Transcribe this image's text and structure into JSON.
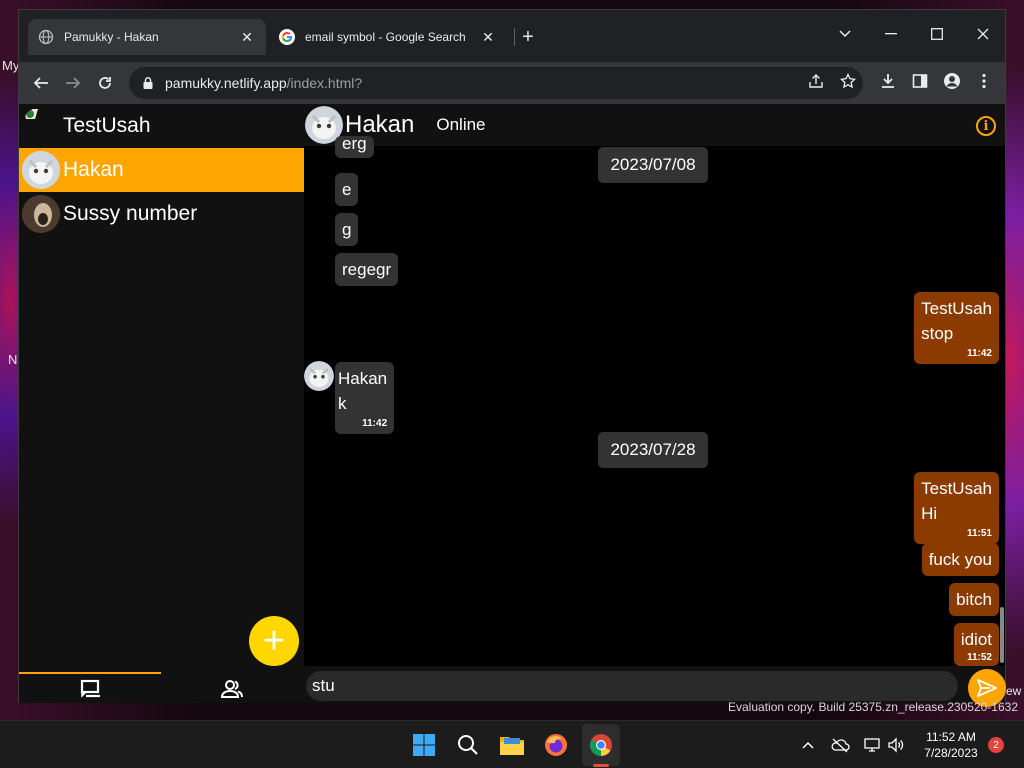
{
  "browser": {
    "tabs": [
      {
        "title": "Pamukky - Hakan",
        "active": true
      },
      {
        "title": "email symbol - Google Search",
        "active": false
      }
    ],
    "url_host": "pamukky.netlify.app",
    "url_path": "/index.html?"
  },
  "sidebar": {
    "contacts": [
      {
        "name": "TestUsah",
        "active": false
      },
      {
        "name": "Hakan",
        "active": true
      },
      {
        "name": "Sussy number",
        "active": false
      }
    ],
    "fab_label": "+"
  },
  "chat": {
    "contact_name": "Hakan",
    "status": "Online",
    "date_chips": [
      "2023/07/08",
      "2023/07/28"
    ],
    "messages": [
      {
        "text": "erg",
        "direction": "in"
      },
      {
        "text": "e",
        "direction": "in"
      },
      {
        "text": "g",
        "direction": "in"
      },
      {
        "text": "regegr",
        "direction": "in"
      },
      {
        "sender": "TestUsah",
        "text": "stop",
        "time": "11:42",
        "direction": "out"
      },
      {
        "sender": "Hakan",
        "text": "k",
        "time": "11:42",
        "direction": "in"
      },
      {
        "sender": "TestUsah",
        "text": "Hi",
        "time": "11:51",
        "direction": "out"
      },
      {
        "text": "fuck you",
        "direction": "out"
      },
      {
        "text": "bitch",
        "direction": "out"
      },
      {
        "text": "idiot",
        "time": "11:52",
        "direction": "out"
      }
    ],
    "composer_value": "stu"
  },
  "desktop": {
    "fragments": [
      "My",
      "N"
    ],
    "watermark": "Evaluation copy. Build 25375.zn_release.230520-1632",
    "watermark_tail": "ew"
  },
  "taskbar": {
    "time": "11:52 AM",
    "date": "7/28/2023",
    "notification_count": "2"
  },
  "colors": {
    "accent": "#ffa500",
    "fab": "#ffd700",
    "outgoing_bubble": "#8b3a00",
    "incoming_bubble": "#333333"
  }
}
